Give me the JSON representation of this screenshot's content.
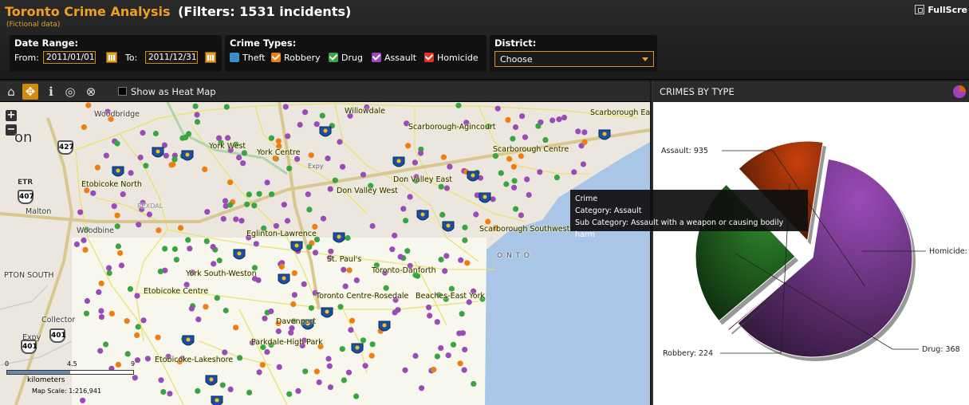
{
  "header": {
    "title": "Toronto Crime Analysis",
    "filter_count": "(Filters: 1531  incidents)",
    "subtitle": "(Fictional data)",
    "fullscreen_label": "FullScre"
  },
  "filters": {
    "date_range": {
      "label": "Date Range:",
      "from_label": "From:",
      "from_value": "2011/01/01",
      "to_label": "To:",
      "to_value": "2011/12/31"
    },
    "crime_types": {
      "label": "Crime Types:",
      "items": [
        {
          "label": "Theft",
          "color": "#3a8fc8",
          "checked": false
        },
        {
          "label": "Robbery",
          "color": "#f07d10",
          "checked": true
        },
        {
          "label": "Drug",
          "color": "#39a540",
          "checked": true
        },
        {
          "label": "Assault",
          "color": "#9a4bb8",
          "checked": true
        },
        {
          "label": "Homicide",
          "color": "#e0302a",
          "checked": true
        }
      ]
    },
    "district": {
      "label": "District:",
      "selected": "Choose"
    }
  },
  "map": {
    "toolbar": {
      "heatmap_label": "Show as Heat Map",
      "tools": [
        "home-icon",
        "pan-icon",
        "info-icon",
        "select-icon",
        "measure-icon"
      ]
    },
    "places": [
      "Woodbridge",
      "on",
      "ETR",
      "Malton",
      "Woodbine",
      "PTON SOUTH",
      "Collector",
      "Expy",
      "Willowdale",
      "York West",
      "York Centre",
      "Etobicoke North",
      "Don Valley West",
      "Don Valley East",
      "Scarborough-Agincourt",
      "Scarborough Centre",
      "Scarborough Southwest",
      "Eglinton-Lawrence",
      "St. Paul's",
      "York South-Weston",
      "Etobicoke Centre",
      "Toronto-Danforth",
      "Toronto Centre-Rosedale",
      "Beaches-East York",
      "Davenport",
      "Parkdale-High Park",
      "Etobicoke-Lakeshore",
      "Scarborough Ea",
      "REXDAL",
      "Expy",
      "401",
      "427",
      "407",
      "401",
      "O  N  T  O"
    ],
    "scale": {
      "t0": "0",
      "t1": "4.5",
      "t2": "9",
      "unit": "kilometers",
      "map_scale": "Map Scale: 1:216,941"
    },
    "tooltip": {
      "title": "Crime",
      "category": "Category: Assault",
      "sub_category": "Sub Category: Assault with a weapon or causing bodily harm"
    }
  },
  "chart": {
    "panel_title": "CRIMES BY TYPE",
    "labels": {
      "assault": "Assault: 935",
      "homicide": "Homicide:",
      "drug": "Drug: 368",
      "robbery": "Robbery: 224"
    }
  },
  "chart_data": {
    "type": "pie",
    "title": "CRIMES BY TYPE",
    "slices": [
      {
        "name": "Assault",
        "value": 935,
        "color": "#9a4bb8"
      },
      {
        "name": "Homicide",
        "value": 4,
        "color": "#e0302a"
      },
      {
        "name": "Drug",
        "value": 368,
        "color": "#2f8a2c"
      },
      {
        "name": "Robbery",
        "value": 224,
        "color": "#c8400c"
      }
    ]
  }
}
